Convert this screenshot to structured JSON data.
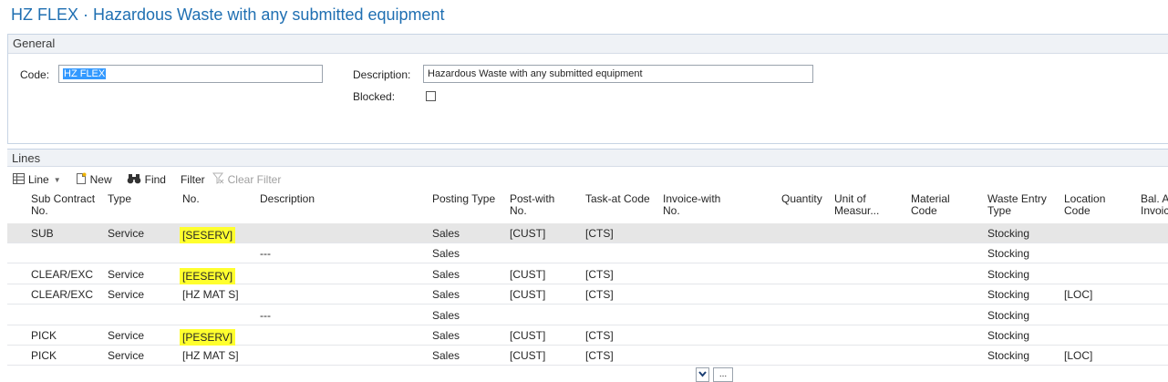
{
  "window": {
    "title": "HZ FLEX · Hazardous Waste with any submitted equipment"
  },
  "general": {
    "section_label": "General",
    "code_label": "Code:",
    "code_value": "HZ FLEX",
    "description_label": "Description:",
    "description_value": "Hazardous Waste with any submitted equipment",
    "blocked_label": "Blocked:",
    "blocked_checked": false
  },
  "lines": {
    "section_label": "Lines",
    "toolbar": {
      "line_label": "Line",
      "new_label": "New",
      "find_label": "Find",
      "filter_label": "Filter",
      "clear_filter_label": "Clear Filter"
    },
    "columns": [
      "Sub Contract\nNo.",
      "Type",
      "No.",
      "Description",
      "Posting Type",
      "Post-with\nNo.",
      "Task-at Code",
      "Invoice-with\nNo.",
      "Quantity",
      "Unit of\nMeasur...",
      "Material\nCode",
      "Waste Entry\nType",
      "Location\nCode",
      "Bal. A\nInvoic"
    ],
    "rows": [
      {
        "sub": "SUB",
        "type": "Service",
        "no": "[SESERV]",
        "desc": "",
        "posting": "Sales",
        "postwith": "[CUST]",
        "task": "[CTS]",
        "waste": "Stocking",
        "loc": "",
        "highlight": true,
        "selected": true
      },
      {
        "sub": "",
        "type": "",
        "no": "",
        "desc": "---",
        "posting": "Sales",
        "postwith": "",
        "task": "",
        "waste": "Stocking",
        "loc": "",
        "highlight": false,
        "selected": false
      },
      {
        "sub": "CLEAR/EXC",
        "type": "Service",
        "no": "[EESERV]",
        "desc": "",
        "posting": "Sales",
        "postwith": "[CUST]",
        "task": "[CTS]",
        "waste": "Stocking",
        "loc": "",
        "highlight": true,
        "selected": false
      },
      {
        "sub": "CLEAR/EXC",
        "type": "Service",
        "no": "[HZ MAT S]",
        "desc": "",
        "posting": "Sales",
        "postwith": "[CUST]",
        "task": "[CTS]",
        "waste": "Stocking",
        "loc": "[LOC]",
        "highlight": false,
        "selected": false
      },
      {
        "sub": "",
        "type": "",
        "no": "",
        "desc": "---",
        "posting": "Sales",
        "postwith": "",
        "task": "",
        "waste": "Stocking",
        "loc": "",
        "highlight": false,
        "selected": false
      },
      {
        "sub": "PICK",
        "type": "Service",
        "no": "[PESERV]",
        "desc": "",
        "posting": "Sales",
        "postwith": "[CUST]",
        "task": "[CTS]",
        "waste": "Stocking",
        "loc": "",
        "highlight": true,
        "selected": false
      },
      {
        "sub": "PICK",
        "type": "Service",
        "no": "[HZ MAT S]",
        "desc": "",
        "posting": "Sales",
        "postwith": "[CUST]",
        "task": "[CTS]",
        "waste": "Stocking",
        "loc": "[LOC]",
        "highlight": false,
        "selected": false
      }
    ],
    "footer": {
      "ellipsis_label": "..."
    }
  },
  "colors": {
    "title": "#1f6fb2",
    "highlight": "#ffff2e",
    "selected_row": "#e6e6e6",
    "section_bg": "#eff2f6"
  }
}
